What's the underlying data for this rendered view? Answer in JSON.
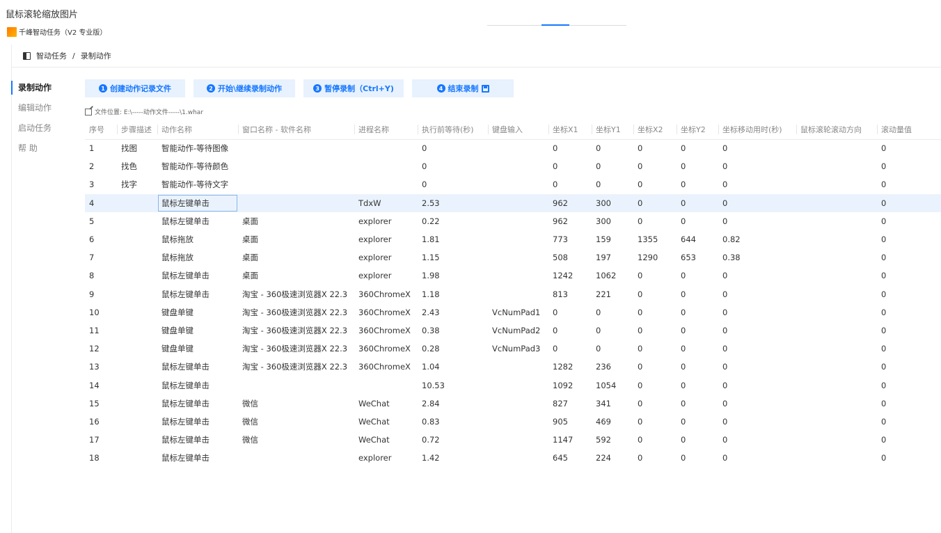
{
  "window": {
    "title": "鼠标滚轮缩放图片"
  },
  "app": {
    "name": "千峰智动任务（V2 专业版）"
  },
  "breadcrumb": {
    "root": "智动任务",
    "separator": "/",
    "current": "录制动作"
  },
  "sidebar": {
    "items": [
      {
        "label": "录制动作"
      },
      {
        "label": "编辑动作"
      },
      {
        "label": "启动任务"
      },
      {
        "label": "帮 助"
      }
    ]
  },
  "toolbar": {
    "create_num": "1",
    "create_label": "创建动作记录文件",
    "start_num": "2",
    "start_label": "开始\\继续录制动作",
    "pause_num": "3",
    "pause_label": "暂停录制（Ctrl+Y)",
    "end_num": "4",
    "end_label": "结束录制"
  },
  "file_location": "文件位置: E:\\-----动作文件-----\\1.whar",
  "table": {
    "headers": [
      "序号",
      "步骤描述",
      "动作名称",
      "窗口名称 - 软件名称",
      "进程名称",
      "执行前等待(秒)",
      "键盘输入",
      "坐标X1",
      "坐标Y1",
      "坐标X2",
      "坐标Y2",
      "坐标移动用时(秒)",
      "鼠标滚轮滚动方向",
      "滚动量值"
    ],
    "rows": [
      [
        "1",
        "找图",
        "智能动作-等待图像",
        "",
        "",
        "0",
        "",
        "0",
        "0",
        "0",
        "0",
        "0",
        "",
        "0"
      ],
      [
        "2",
        "找色",
        "智能动作-等待颜色",
        "",
        "",
        "0",
        "",
        "0",
        "0",
        "0",
        "0",
        "0",
        "",
        "0"
      ],
      [
        "3",
        "找字",
        "智能动作-等待文字",
        "",
        "",
        "0",
        "",
        "0",
        "0",
        "0",
        "0",
        "0",
        "",
        "0"
      ],
      [
        "4",
        "",
        "鼠标左键单击",
        "",
        "TdxW",
        "2.53",
        "",
        "962",
        "300",
        "0",
        "0",
        "0",
        "",
        "0"
      ],
      [
        "5",
        "",
        "鼠标左键单击",
        "桌面",
        "explorer",
        "0.22",
        "",
        "962",
        "300",
        "0",
        "0",
        "0",
        "",
        "0"
      ],
      [
        "6",
        "",
        "鼠标拖放",
        "桌面",
        "explorer",
        "1.81",
        "",
        "773",
        "159",
        "1355",
        "644",
        "0.82",
        "",
        "0"
      ],
      [
        "7",
        "",
        "鼠标拖放",
        "桌面",
        "explorer",
        "1.15",
        "",
        "508",
        "197",
        "1290",
        "653",
        "0.38",
        "",
        "0"
      ],
      [
        "8",
        "",
        "鼠标左键单击",
        "桌面",
        "explorer",
        "1.98",
        "",
        "1242",
        "1062",
        "0",
        "0",
        "0",
        "",
        "0"
      ],
      [
        "9",
        "",
        "鼠标左键单击",
        "淘宝 - 360极速浏览器X 22.3",
        "360ChromeX",
        "1.18",
        "",
        "813",
        "221",
        "0",
        "0",
        "0",
        "",
        "0"
      ],
      [
        "10",
        "",
        "键盘单键",
        "淘宝 - 360极速浏览器X 22.3",
        "360ChromeX",
        "2.43",
        "VcNumPad1",
        "0",
        "0",
        "0",
        "0",
        "0",
        "",
        "0"
      ],
      [
        "11",
        "",
        "键盘单键",
        "淘宝 - 360极速浏览器X 22.3",
        "360ChromeX",
        "0.38",
        "VcNumPad2",
        "0",
        "0",
        "0",
        "0",
        "0",
        "",
        "0"
      ],
      [
        "12",
        "",
        "键盘单键",
        "淘宝 - 360极速浏览器X 22.3",
        "360ChromeX",
        "0.28",
        "VcNumPad3",
        "0",
        "0",
        "0",
        "0",
        "0",
        "",
        "0"
      ],
      [
        "13",
        "",
        "鼠标左键单击",
        "淘宝 - 360极速浏览器X 22.3",
        "360ChromeX",
        "1.04",
        "",
        "1282",
        "236",
        "0",
        "0",
        "0",
        "",
        "0"
      ],
      [
        "14",
        "",
        "鼠标左键单击",
        "",
        "",
        "10.53",
        "",
        "1092",
        "1054",
        "0",
        "0",
        "0",
        "",
        "0"
      ],
      [
        "15",
        "",
        "鼠标左键单击",
        "微信",
        "WeChat",
        "2.84",
        "",
        "827",
        "341",
        "0",
        "0",
        "0",
        "",
        "0"
      ],
      [
        "16",
        "",
        "鼠标左键单击",
        "微信",
        "WeChat",
        "0.83",
        "",
        "905",
        "469",
        "0",
        "0",
        "0",
        "",
        "0"
      ],
      [
        "17",
        "",
        "鼠标左键单击",
        "微信",
        "WeChat",
        "0.72",
        "",
        "1147",
        "592",
        "0",
        "0",
        "0",
        "",
        "0"
      ],
      [
        "18",
        "",
        "鼠标左键单击",
        "",
        "explorer",
        "1.42",
        "",
        "645",
        "224",
        "0",
        "0",
        "0",
        "",
        "0"
      ]
    ],
    "selected_row": 4
  },
  "colors": {
    "accent": "#1677ff",
    "button_bg": "#e8f2fe",
    "selected_row": "#eaf3fd"
  }
}
